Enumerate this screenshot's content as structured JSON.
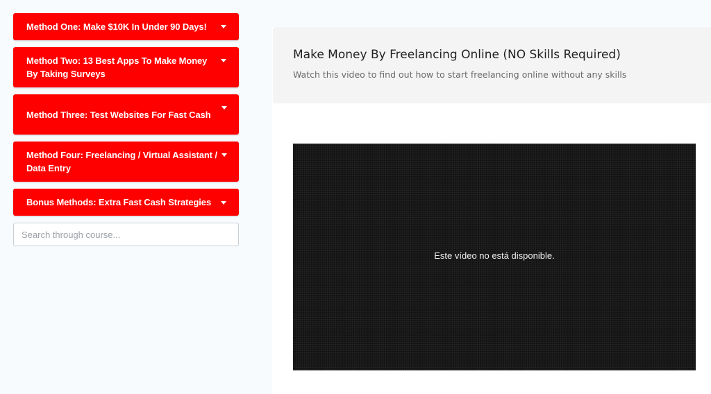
{
  "sidebar": {
    "methods": [
      {
        "label": "Method One: Make $10K In Under 90 Days!"
      },
      {
        "label": "Method Two: 13 Best Apps To Make Money By Taking Surveys"
      },
      {
        "label": "Method Three: Test Websites For Fast Cash"
      },
      {
        "label": "Method Four: Freelancing / Virtual Assistant / Data Entry"
      },
      {
        "label": "Bonus Methods: Extra Fast Cash Strategies"
      }
    ],
    "search": {
      "placeholder": "Search through course...",
      "value": ""
    }
  },
  "main": {
    "header": {
      "title": "Make Money By Freelancing Online (NO Skills Required)",
      "subtitle": "Watch this video to find out how to start freelancing online without any skills"
    },
    "video": {
      "message": "Este vídeo no está disponible."
    }
  },
  "colors": {
    "accent": "#ff0000",
    "page_bg": "#f7fbfe",
    "header_card_bg": "#f4f4f4",
    "video_bg": "#161616"
  },
  "icons": {
    "method_toggle": "caret-down-icon"
  }
}
